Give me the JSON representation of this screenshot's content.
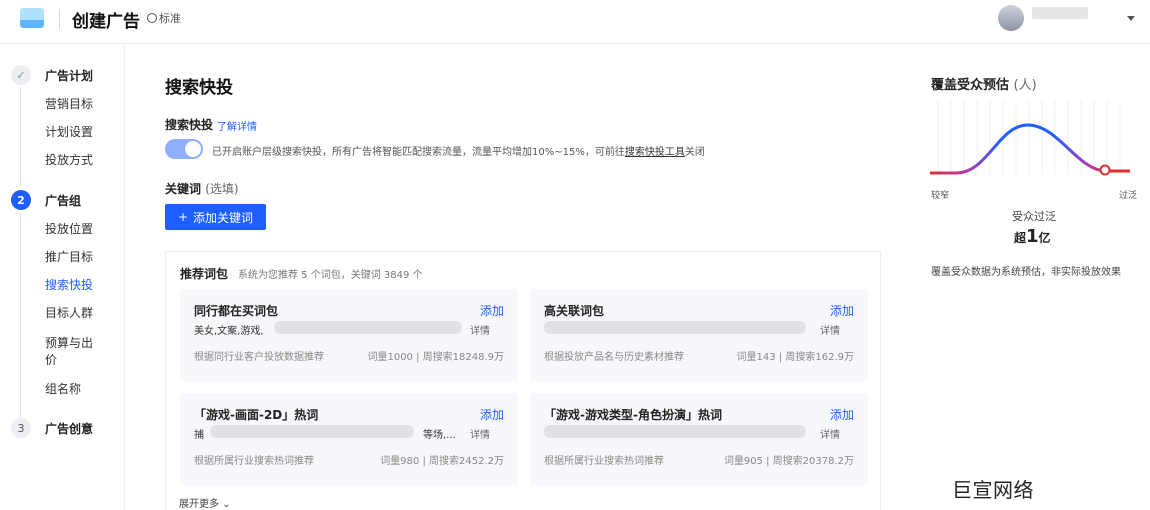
{
  "header": {
    "title": "创建广告",
    "badge": "标准"
  },
  "sidebar": {
    "steps": [
      {
        "num": "✓",
        "label": "广告计划"
      },
      {
        "num": "2",
        "label": "广告组"
      },
      {
        "num": "3",
        "label": "广告创意"
      }
    ],
    "plan_items": [
      "营销目标",
      "计划设置",
      "投放方式"
    ],
    "group_items": [
      "投放位置",
      "推广目标",
      "搜索快投",
      "目标人群",
      "预算与出",
      "价",
      "组名称"
    ]
  },
  "main": {
    "title": "搜索快投",
    "search_label": "搜索快投",
    "learn_more": "了解详情",
    "toggle_on": true,
    "toggle_desc": "已开启账户层级搜索快投，所有广告将智能匹配搜索流量，流量平均增加10%~15%，可前往",
    "toggle_link": "搜索快投工具",
    "toggle_desc_end": "关闭",
    "keywords_label": "关键词",
    "keywords_optional": "(选填)",
    "add_keyword_button": "添加关键词",
    "panel": {
      "title": "推荐词包",
      "subtitle": "系统为您推荐 5 个词包，关键词 3849 个",
      "expand": "展开更多",
      "cards": [
        {
          "title": "同行都在买词包",
          "add": "添加",
          "keywords": "美女,文案,游戏,",
          "detail": "详情",
          "source": "根据同行业客户投放数据推荐",
          "stats": "词量1000 | 周搜索18248.9万"
        },
        {
          "title": "高关联词包",
          "add": "添加",
          "keywords": "",
          "detail": "详情",
          "source": "根据投放产品名与历史素材推荐",
          "stats": "词量143 | 周搜索162.9万"
        },
        {
          "title": "「游戏-画面-2D」热词",
          "add": "添加",
          "keywords": "捕",
          "keywords_tail": "等场,...",
          "detail": "详情",
          "source": "根据所属行业搜索热词推荐",
          "stats": "词量980 | 周搜索2452.2万"
        },
        {
          "title": "「游戏-游戏类型-角色扮演」热词",
          "add": "添加",
          "keywords": "",
          "detail": "详情",
          "source": "根据所属行业搜索热词推荐",
          "stats": "词量905 | 周搜索20378.2万"
        }
      ]
    }
  },
  "right_panel": {
    "title": "覆盖受众预估",
    "unit": "(人)",
    "axis_left": "较窄",
    "axis_right": "过泛",
    "state": "受众过泛",
    "estimate_prefix": "超",
    "estimate_value": "1",
    "estimate_unit": "亿",
    "note": "覆盖受众数据为系统预估，非实际投放效果",
    "colors": {
      "left": "#e03030",
      "mid": "#1f5eff",
      "right": "#e03030"
    }
  },
  "watermark": "巨宣网络"
}
